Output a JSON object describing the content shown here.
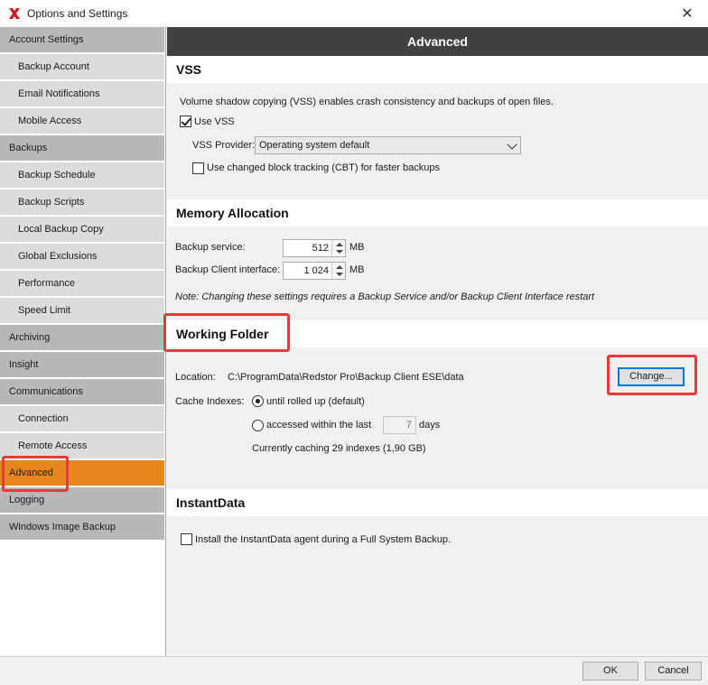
{
  "window": {
    "title": "Options and Settings",
    "close_glyph": "✕",
    "icon": "redstor-logo-icon"
  },
  "sidebar": {
    "items": [
      {
        "label": "Account Settings",
        "kind": "category"
      },
      {
        "label": "Backup Account",
        "kind": "sub"
      },
      {
        "label": "Email Notifications",
        "kind": "sub"
      },
      {
        "label": "Mobile Access",
        "kind": "sub"
      },
      {
        "label": "Backups",
        "kind": "category"
      },
      {
        "label": "Backup Schedule",
        "kind": "sub"
      },
      {
        "label": "Backup Scripts",
        "kind": "sub"
      },
      {
        "label": "Local Backup Copy",
        "kind": "sub"
      },
      {
        "label": "Global Exclusions",
        "kind": "sub"
      },
      {
        "label": "Performance",
        "kind": "sub"
      },
      {
        "label": "Speed Limit",
        "kind": "sub"
      },
      {
        "label": "Archiving",
        "kind": "category"
      },
      {
        "label": "Insight",
        "kind": "category"
      },
      {
        "label": "Communications",
        "kind": "category"
      },
      {
        "label": "Connection",
        "kind": "sub"
      },
      {
        "label": "Remote Access",
        "kind": "sub"
      },
      {
        "label": "Advanced",
        "kind": "active"
      },
      {
        "label": "Logging",
        "kind": "category"
      },
      {
        "label": "Windows Image Backup",
        "kind": "category"
      }
    ]
  },
  "content": {
    "header": "Advanced",
    "vss": {
      "title": "VSS",
      "description": "Volume shadow copying (VSS) enables crash consistency and backups of open files.",
      "use_vss_label": "Use VSS",
      "use_vss_checked": true,
      "provider_label": "VSS Provider:",
      "provider_value": "Operating system default",
      "cbt_label": "Use changed block tracking (CBT) for faster backups",
      "cbt_checked": false
    },
    "memory": {
      "title": "Memory Allocation",
      "service_label": "Backup service:",
      "service_value": "512",
      "service_unit": "MB",
      "client_label": "Backup Client interface:",
      "client_value": "1 024",
      "client_unit": "MB",
      "note": "Note: Changing these settings requires a Backup Service and/or Backup Client Interface restart"
    },
    "working_folder": {
      "title": "Working Folder",
      "location_label": "Location:",
      "location_value": "C:\\ProgramData\\Redstor Pro\\Backup Client ESE\\data",
      "change_button": "Change...",
      "cache_label": "Cache Indexes:",
      "option_rolled_up": "until rolled up (default)",
      "option_accessed": "accessed within the last",
      "days_value": "7",
      "days_unit": "days",
      "caching_info": "Currently caching 29 indexes (1,90 GB)"
    },
    "instantdata": {
      "title": "InstantData",
      "install_label": "Install the InstantData agent during a Full System Backup.",
      "install_checked": false
    }
  },
  "footer": {
    "ok_label": "OK",
    "cancel_label": "Cancel"
  },
  "colors": {
    "active_item": "#e8861d",
    "header_bg": "#414141",
    "highlight": "#e23c3c"
  }
}
